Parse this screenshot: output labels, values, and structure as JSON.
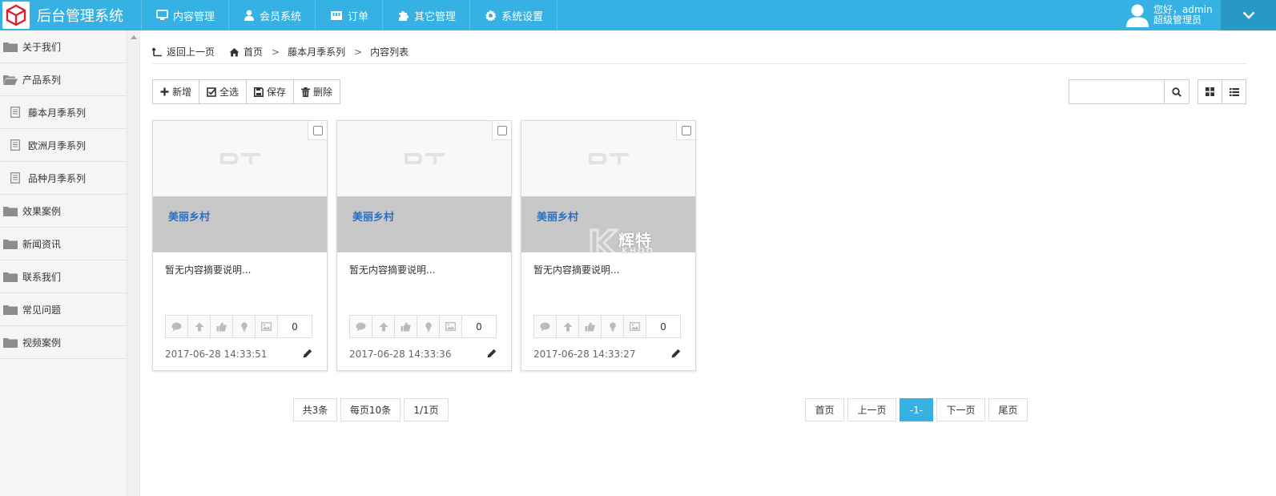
{
  "app": {
    "title": "后台管理系统"
  },
  "nav": [
    {
      "label": "内容管理",
      "icon": "monitor-icon"
    },
    {
      "label": "会员系统",
      "icon": "user-icon"
    },
    {
      "label": "订单",
      "icon": "order-icon"
    },
    {
      "label": "其它管理",
      "icon": "puzzle-icon"
    },
    {
      "label": "系统设置",
      "icon": "gear-icon"
    }
  ],
  "user": {
    "greeting": "您好，admin",
    "role": "超级管理员"
  },
  "sidebar": {
    "items": [
      {
        "label": "关于我们",
        "icon": "folder-icon"
      },
      {
        "label": "产品系列",
        "icon": "folder-open-icon"
      },
      {
        "label": "藤本月季系列",
        "icon": "document-icon"
      },
      {
        "label": "欧洲月季系列",
        "icon": "document-icon"
      },
      {
        "label": "品种月季系列",
        "icon": "document-icon"
      },
      {
        "label": "效果案例",
        "icon": "folder-icon"
      },
      {
        "label": "新闻资讯",
        "icon": "folder-icon"
      },
      {
        "label": "联系我们",
        "icon": "folder-icon"
      },
      {
        "label": "常见问题",
        "icon": "folder-icon"
      },
      {
        "label": "视频案例",
        "icon": "folder-icon"
      }
    ]
  },
  "breadcrumb": {
    "back": "返回上一页",
    "home": "首页",
    "category": "藤本月季系列",
    "current": "内容列表"
  },
  "toolbar": {
    "add": "新增",
    "select_all": "全选",
    "save": "保存",
    "delete": "删除"
  },
  "search": {
    "placeholder": ""
  },
  "cards": [
    {
      "title": "美丽乡村",
      "summary": "暂无内容摘要说明...",
      "count": "0",
      "date": "2017-06-28 14:33:51"
    },
    {
      "title": "美丽乡村",
      "summary": "暂无内容摘要说明...",
      "count": "0",
      "date": "2017-06-28 14:33:36"
    },
    {
      "title": "美丽乡村",
      "summary": "暂无内容摘要说明...",
      "count": "0",
      "date": "2017-06-28 14:33:27"
    }
  ],
  "pagination": {
    "total": "共3条",
    "per_page": "每页10条",
    "pages": "1/1页",
    "first": "首页",
    "prev": "上一页",
    "current": "-1-",
    "next": "下一页",
    "last": "尾页"
  },
  "watermark": {
    "text": "辉特",
    "sub": "KHOO"
  },
  "colors": {
    "accent": "#35b2e3",
    "accent_dark": "#2899c6",
    "title_link": "#2a6ebd",
    "card_band": "#c8c8c8"
  }
}
